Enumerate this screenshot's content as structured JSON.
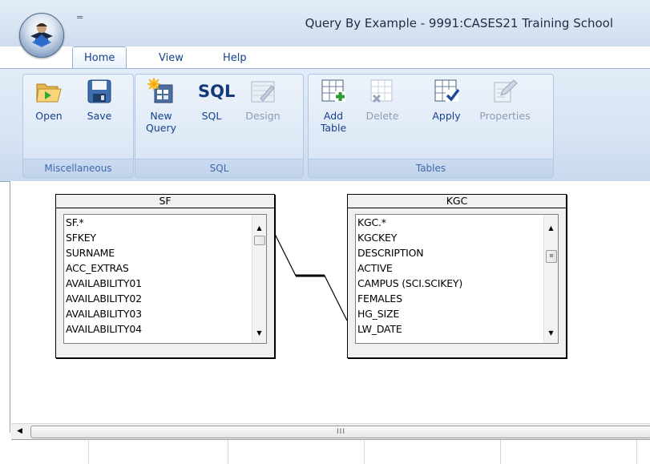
{
  "window": {
    "title": "Query By Example - 9991:CASES21 Training School",
    "qat_symbol": "="
  },
  "tabs": [
    {
      "label": "Home",
      "active": true
    },
    {
      "label": "View",
      "active": false
    },
    {
      "label": "Help",
      "active": false
    }
  ],
  "ribbon": {
    "groups": {
      "miscellaneous": {
        "label": "Miscellaneous"
      },
      "sql": {
        "label": "SQL"
      },
      "tables": {
        "label": "Tables"
      }
    },
    "buttons": {
      "open": {
        "label": "Open",
        "icon": "folder-open-icon"
      },
      "save": {
        "label": "Save",
        "icon": "floppy-disk-icon"
      },
      "new_query": {
        "label_1": "New",
        "label_2": "Query",
        "icon": "new-query-icon"
      },
      "sql": {
        "label": "SQL",
        "icon_text": "SQL",
        "icon": "sql-icon"
      },
      "design": {
        "label": "Design",
        "icon": "design-icon",
        "disabled": true
      },
      "add_table": {
        "label_1": "Add",
        "label_2": "Table",
        "icon": "add-table-icon"
      },
      "delete": {
        "label": "Delete",
        "icon": "delete-table-icon",
        "disabled": true
      },
      "apply": {
        "label": "Apply",
        "icon": "apply-table-icon"
      },
      "properties": {
        "label": "Properties",
        "icon": "properties-icon",
        "disabled": true
      }
    }
  },
  "tables": [
    {
      "name": "SF",
      "fields": [
        "SF.*",
        "SFKEY",
        "SURNAME",
        "ACC_EXTRAS",
        "AVAILABILITY01",
        "AVAILABILITY02",
        "AVAILABILITY03",
        "AVAILABILITY04"
      ]
    },
    {
      "name": "KGC",
      "fields": [
        "KGC.*",
        "KGCKEY",
        "DESCRIPTION",
        "ACTIVE",
        "CAMPUS  (SCI.SCIKEY)",
        "FEMALES",
        "HG_SIZE",
        "LW_DATE"
      ]
    }
  ],
  "scrollbar": {
    "grip": "III"
  },
  "colors": {
    "ribbon_text": "#15428b",
    "group_label": "#3e6aaa",
    "disabled": "#8d9db3"
  }
}
